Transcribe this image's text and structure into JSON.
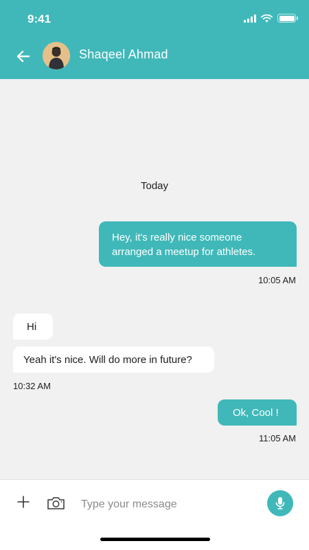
{
  "status_bar": {
    "time": "9:41"
  },
  "header": {
    "contact_name": "Shaqeel Ahmad"
  },
  "chat": {
    "date_label": "Today",
    "messages": [
      {
        "direction": "outgoing",
        "text": "Hey, it's really nice someone arranged a meetup for athletes.",
        "time": "10:05 AM"
      },
      {
        "direction": "incoming",
        "text": "Hi"
      },
      {
        "direction": "incoming",
        "text": "Yeah it's nice. Will do more in future?",
        "time": "10:32 AM"
      },
      {
        "direction": "outgoing",
        "text": "Ok, Cool !",
        "time": "11:05 AM"
      }
    ]
  },
  "composer": {
    "placeholder": "Type your message"
  },
  "icons": {
    "back": "arrow-left-icon",
    "plus": "plus-icon",
    "camera": "camera-icon",
    "mic": "microphone-icon"
  },
  "colors": {
    "accent": "#40b8b9",
    "background": "#f1f1f1",
    "incoming_bubble": "#ffffff"
  }
}
